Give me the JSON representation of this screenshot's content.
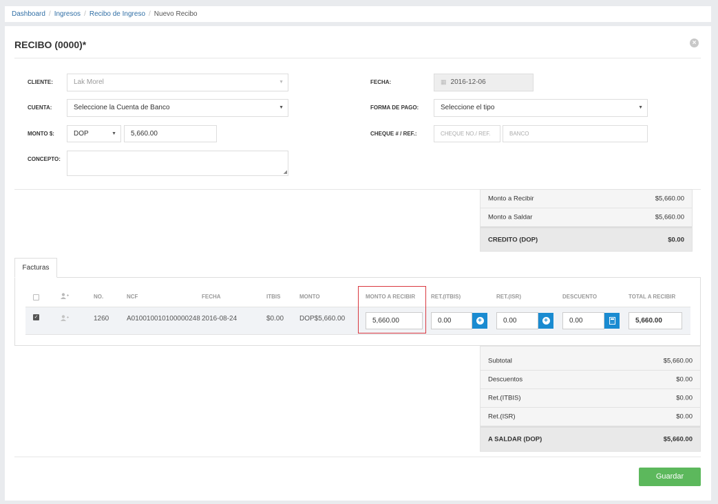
{
  "breadcrumb": {
    "items": [
      "Dashboard",
      "Ingresos",
      "Recibo de Ingreso"
    ],
    "current": "Nuevo Recibo",
    "separator": "/"
  },
  "form": {
    "title": "RECIBO (0000)*",
    "cliente_label": "CLIENTE:",
    "cliente_value": "Lak Morel",
    "cuenta_label": "CUENTA:",
    "cuenta_value": "Seleccione la Cuenta de Banco",
    "monto_label": "MONTO $:",
    "currency_value": "DOP",
    "monto_value": "5,660.00",
    "concepto_label": "CONCEPTO:",
    "concepto_value": "",
    "fecha_label": "FECHA:",
    "fecha_value": "2016-12-06",
    "forma_pago_label": "FORMA DE PAGO:",
    "forma_pago_value": "Seleccione el tipo",
    "cheque_label": "CHEQUE # / REF.:",
    "cheque_placeholder": "CHEQUE NO./ REF.",
    "banco_placeholder": "BANCO"
  },
  "top_summary": {
    "rows": [
      {
        "label": "Monto a Recibir",
        "value": "$5,660.00"
      },
      {
        "label": "Monto a Saldar",
        "value": "$5,660.00"
      }
    ],
    "total": {
      "label": "CREDITO (DOP)",
      "value": "$0.00"
    }
  },
  "tabs": [
    {
      "label": "Facturas",
      "active": true
    }
  ],
  "invoices": {
    "columns": [
      "NO.",
      "NCF",
      "FECHA",
      "ITBIS",
      "MONTO",
      "MONTO A RECIBIR",
      "RET.(ITBIS)",
      "RET.(ISR)",
      "DESCUENTO",
      "TOTAL A RECIBIR"
    ],
    "rows": [
      {
        "checked": true,
        "no": "1260",
        "ncf": "A010010010100000248",
        "fecha": "2016-08-24",
        "itbis": "$0.00",
        "monto": "DOP$5,660.00",
        "monto_a_recibir": "5,660.00",
        "ret_itbis": "0.00",
        "ret_isr": "0.00",
        "descuento": "0.00",
        "total_a_recibir": "5,660.00"
      }
    ]
  },
  "bottom_summary": {
    "rows": [
      {
        "label": "Subtotal",
        "value": "$5,660.00"
      },
      {
        "label": "Descuentos",
        "value": "$0.00"
      },
      {
        "label": "Ret.(ITBIS)",
        "value": "$0.00"
      },
      {
        "label": "Ret.(ISR)",
        "value": "$0.00"
      }
    ],
    "total": {
      "label": "A SALDAR (DOP)",
      "value": "$5,660.00"
    }
  },
  "actions": {
    "save_label": "Guardar"
  },
  "colors": {
    "primary_button": "#5cb85c",
    "action_button": "#1a8bd1",
    "highlight_border": "#d9363e",
    "link": "#2f6ea5"
  },
  "icons": [
    "close-icon",
    "calendar-icon",
    "caret-down-icon",
    "add-user-icon",
    "user-icon",
    "plus-circle-icon",
    "calculator-icon"
  ]
}
